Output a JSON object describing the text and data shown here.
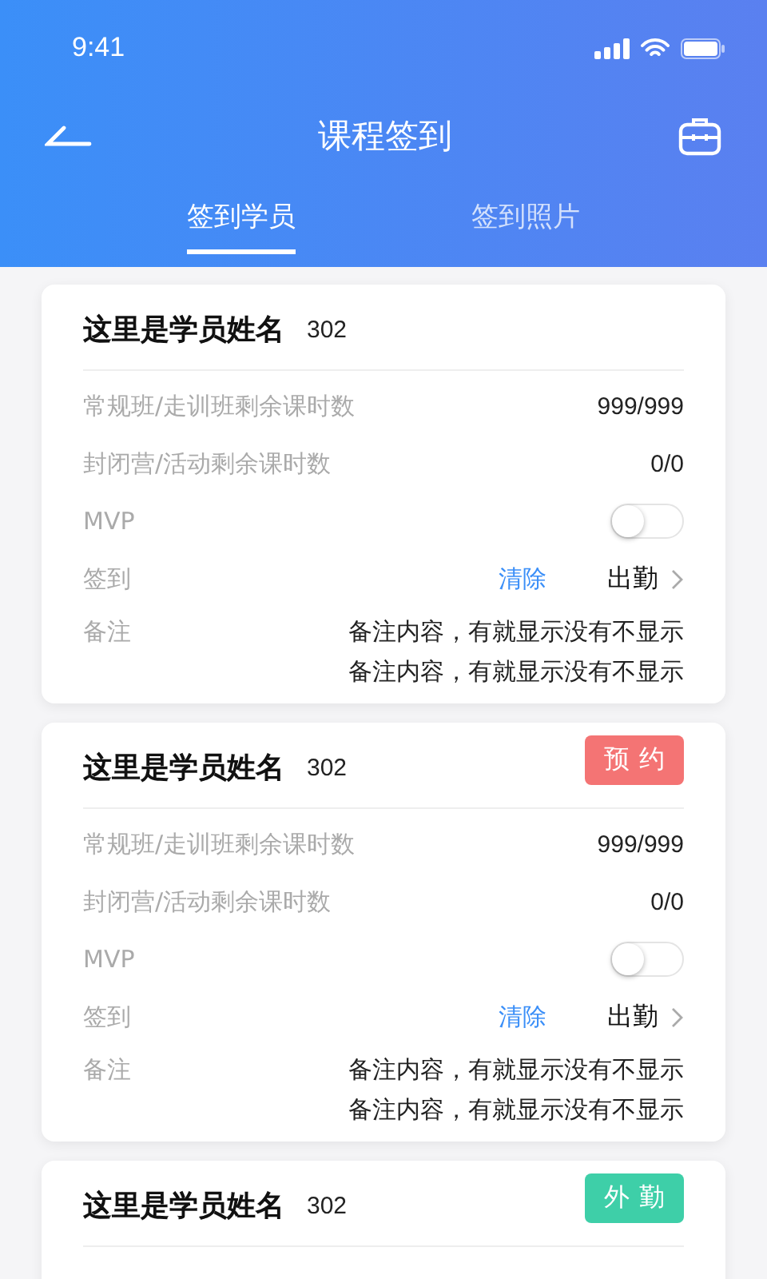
{
  "status_bar": {
    "time": "9:41"
  },
  "header": {
    "title": "课程签到"
  },
  "tabs": [
    {
      "label": "签到学员",
      "selected": true
    },
    {
      "label": "签到照片",
      "selected": false
    }
  ],
  "cards": [
    {
      "name": "这里是学员姓名",
      "number": "302",
      "rows": [
        {
          "kind": "value",
          "label": "常规班/走训班剩余课时数",
          "value": "999/999"
        },
        {
          "kind": "value",
          "label": "封闭营/活动剩余课时数",
          "value": "0/0"
        },
        {
          "kind": "toggle",
          "label": "MVP",
          "on": false
        },
        {
          "kind": "signin",
          "label": "签到",
          "action": "清除",
          "status": "出勤"
        },
        {
          "kind": "note",
          "label": "备注",
          "lines": [
            "备注内容，有就显示没有不显示",
            "备注内容，有就显示没有不显示"
          ]
        }
      ]
    },
    {
      "name": "这里是学员姓名",
      "number": "302",
      "badge": {
        "label": "预约",
        "color": "#f47474"
      },
      "rows": [
        {
          "kind": "value",
          "label": "常规班/走训班剩余课时数",
          "value": "999/999"
        },
        {
          "kind": "value",
          "label": "封闭营/活动剩余课时数",
          "value": "0/0"
        },
        {
          "kind": "toggle",
          "label": "MVP",
          "on": false
        },
        {
          "kind": "signin",
          "label": "签到",
          "action": "清除",
          "status": "出勤"
        },
        {
          "kind": "note",
          "label": "备注",
          "lines": [
            "备注内容，有就显示没有不显示",
            "备注内容，有就显示没有不显示"
          ]
        }
      ]
    },
    {
      "name": "这里是学员姓名",
      "number": "302",
      "badge": {
        "label": "外勤",
        "color": "#3ecfa8"
      }
    }
  ]
}
